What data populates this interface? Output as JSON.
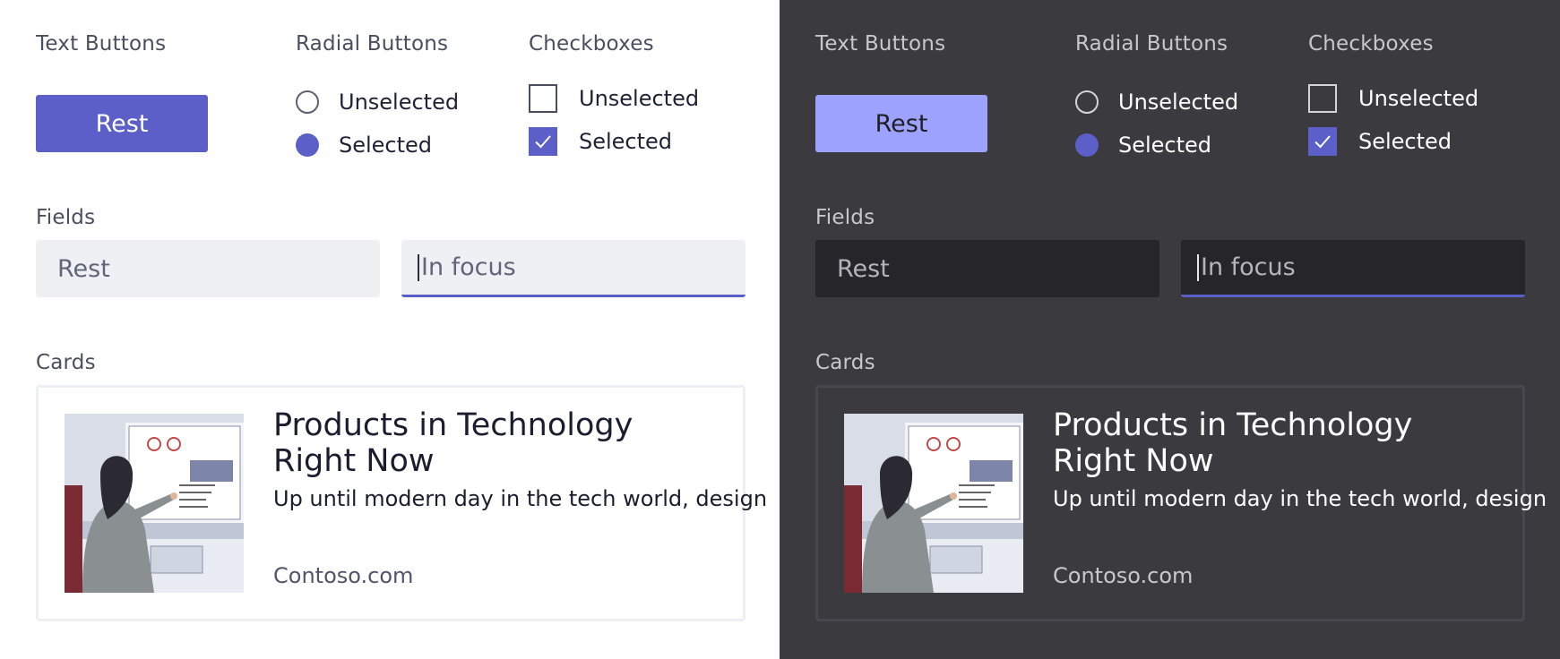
{
  "sections": {
    "text_buttons": "Text Buttons",
    "radial_buttons": "Radial Buttons",
    "checkboxes": "Checkboxes",
    "fields": "Fields",
    "cards": "Cards"
  },
  "button": {
    "label": "Rest"
  },
  "radios": {
    "unselected": "Unselected",
    "selected": "Selected"
  },
  "checks": {
    "unselected": "Unselected",
    "selected": "Selected"
  },
  "fields": {
    "rest": "Rest",
    "focus": "In focus"
  },
  "card": {
    "title": "Products in Technology Right Now",
    "description": "Up until modern day in the tech world, design",
    "source": "Contoso.com",
    "image_icon": "presenter-whiteboard-photo"
  },
  "colors": {
    "brand": "#5b5fc7",
    "brand_dark_theme_button": "#9ea2ff",
    "light_bg": "#ffffff",
    "dark_bg": "#3b3a3f"
  }
}
